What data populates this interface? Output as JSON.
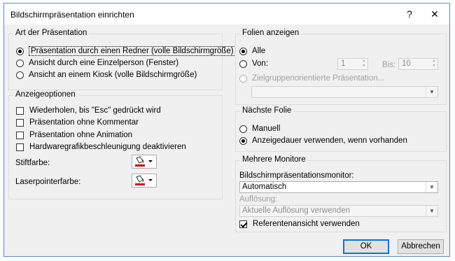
{
  "window": {
    "title": "Bildschirmpräsentation einrichten",
    "help_icon": "?",
    "close_icon": "✕"
  },
  "art": {
    "label": "Art der Präsentation",
    "options": [
      {
        "label": "Präsentation durch einen Redner (volle Bildschirmgröße)",
        "selected": true
      },
      {
        "label": "Ansicht durch eine Einzelperson (Fenster)",
        "selected": false
      },
      {
        "label": "Ansicht an einem Kiosk (volle Bildschirmgröße)",
        "selected": false
      }
    ]
  },
  "anzeige": {
    "label": "Anzeigeoptionen",
    "checkboxes": [
      {
        "label": "Wiederholen, bis \"Esc\" gedrückt wird",
        "checked": false
      },
      {
        "label": "Präsentation ohne Kommentar",
        "checked": false
      },
      {
        "label": "Präsentation ohne Animation",
        "checked": false
      },
      {
        "label": "Hardwaregrafikbeschleunigung deaktivieren",
        "checked": false
      }
    ],
    "pen_color_label": "Stiftfarbe:",
    "laser_color_label": "Laserpointerfarbe:"
  },
  "folien": {
    "label": "Folien anzeigen",
    "all_label": "Alle",
    "from_label": "Von:",
    "from_value": "1",
    "to_label": "Bis:",
    "to_value": "10",
    "custom_label": "Zielgruppenorientierte Präsentation...",
    "custom_value": ""
  },
  "naechste": {
    "label": "Nächste Folie",
    "manual_label": "Manuell",
    "timing_label": "Anzeigedauer verwenden, wenn vorhanden"
  },
  "monitore": {
    "label": "Mehrere Monitore",
    "monitor_label": "Bildschirmpräsentationsmonitor:",
    "monitor_value": "Automatisch",
    "resolution_label": "Auflösung:",
    "resolution_value": "Aktuelle Auflösung verwenden",
    "presenter_view_label": "Referentenansicht verwenden",
    "presenter_view_checked": true
  },
  "buttons": {
    "ok": "OK",
    "cancel": "Abbrechen"
  },
  "colors": {
    "pen": "#c00000",
    "laser": "#e00000",
    "accent": "#0078d7"
  }
}
